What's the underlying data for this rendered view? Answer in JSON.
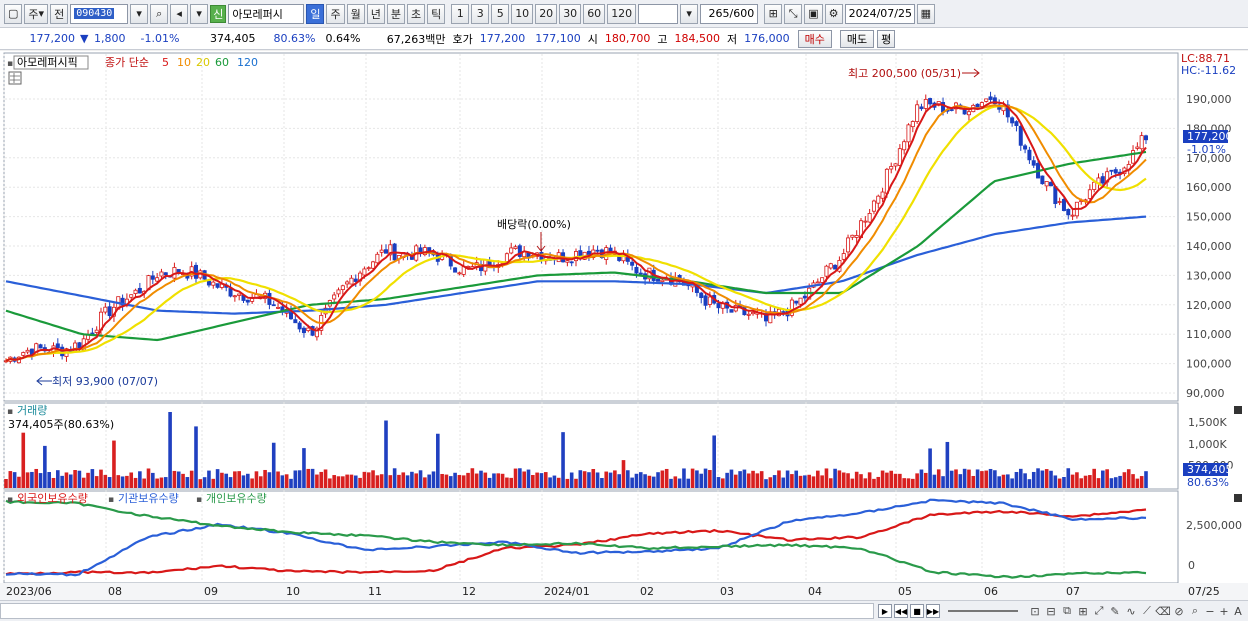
{
  "toolbar": {
    "period_kind": "주",
    "prev_label": "전",
    "code": "090430",
    "new_badge": "신",
    "stock_name": "아모레퍼시",
    "period_buttons": [
      "일",
      "주",
      "월",
      "년",
      "분",
      "초",
      "틱"
    ],
    "active_period": "일",
    "interval_buttons": [
      "1",
      "3",
      "5",
      "10",
      "20",
      "30",
      "60",
      "120"
    ],
    "count_value": "265",
    "count_total": "/600",
    "date": "2024/07/25"
  },
  "quote": {
    "price": "177,200",
    "change": "1,800",
    "change_pct": "-1.01%",
    "volume": "374,405",
    "vol_ratio": "80.63%",
    "turnover": "0.64%",
    "amount": "67,263백만",
    "bid_label": "호가",
    "bid_sell": "177,200",
    "bid_buy": "177,100",
    "open_label": "시",
    "open": "180,700",
    "high_label": "고",
    "high": "184,500",
    "low_label": "저",
    "low": "176,000",
    "buy_label": "매수",
    "sell_label": "매도",
    "eval_label": "평"
  },
  "price_panel": {
    "legend": {
      "name": "아모레퍼시픽",
      "series_label": "종가 단순",
      "ma": [
        {
          "label": "5",
          "color": "#d81818"
        },
        {
          "label": "10",
          "color": "#f08c00"
        },
        {
          "label": "20",
          "color": "#f0e000"
        },
        {
          "label": "60",
          "color": "#1a9a3a"
        },
        {
          "label": "120",
          "color": "#1a70d0"
        }
      ]
    },
    "lc_label": "LC:88.71",
    "hc_label": "HC:-11.62",
    "current_price_tag": "177,200",
    "current_pct_tag": "-1.01%",
    "annotations": {
      "high": "최고 200,500 (05/31)",
      "low": "최저 93,900 (07/07)",
      "dividend": "배당락(0.00%)"
    },
    "y_ticks": [
      "190,000",
      "180,000",
      "170,000",
      "160,000",
      "150,000",
      "140,000",
      "130,000",
      "120,000",
      "110,000",
      "100,000",
      "90,000"
    ]
  },
  "volume_panel": {
    "title": "거래량",
    "value_label": "374,405주(80.63%)",
    "y_ticks": [
      "1,500K",
      "1,000K",
      "500,000"
    ],
    "tag_value": "374,405",
    "tag_pct": "80.63%"
  },
  "holdings_panel": {
    "legend": [
      {
        "label": "외국인보유수량",
        "color": "#d81818"
      },
      {
        "label": "기관보유수량",
        "color": "#2a5fd8"
      },
      {
        "label": "개인보유수량",
        "color": "#2a9a4a"
      }
    ],
    "y_ticks": [
      "2,500,000",
      "0"
    ]
  },
  "x_axis": {
    "labels": [
      "2023/06",
      "08",
      "09",
      "10",
      "11",
      "12",
      "2024/01",
      "02",
      "03",
      "04",
      "05",
      "06",
      "07",
      "07/25"
    ]
  },
  "chart_data": {
    "type": "line",
    "title": "아모레퍼시픽",
    "x": [
      "2023/06",
      "08",
      "09",
      "10",
      "11",
      "12",
      "2024/01",
      "02",
      "03",
      "04",
      "05",
      "06",
      "07"
    ],
    "ylim": [
      88000,
      201000
    ],
    "series": [
      {
        "name": "종가",
        "values": [
          101000,
          108000,
          132000,
          126000,
          112000,
          140000,
          133000,
          138000,
          137000,
          125000,
          113000,
          135000,
          186000,
          190000,
          150000,
          177200
        ]
      },
      {
        "name": "120",
        "values": [
          128000,
          123000,
          118000,
          117000,
          118000,
          120000,
          124000,
          128000,
          128000,
          127000,
          124000,
          128000,
          137000,
          144000,
          148000,
          150000
        ]
      },
      {
        "name": "60",
        "values": [
          118000,
          110000,
          108000,
          114000,
          120000,
          122000,
          126000,
          130000,
          131000,
          128000,
          124000,
          124000,
          140000,
          162000,
          168000,
          172000
        ]
      }
    ]
  }
}
